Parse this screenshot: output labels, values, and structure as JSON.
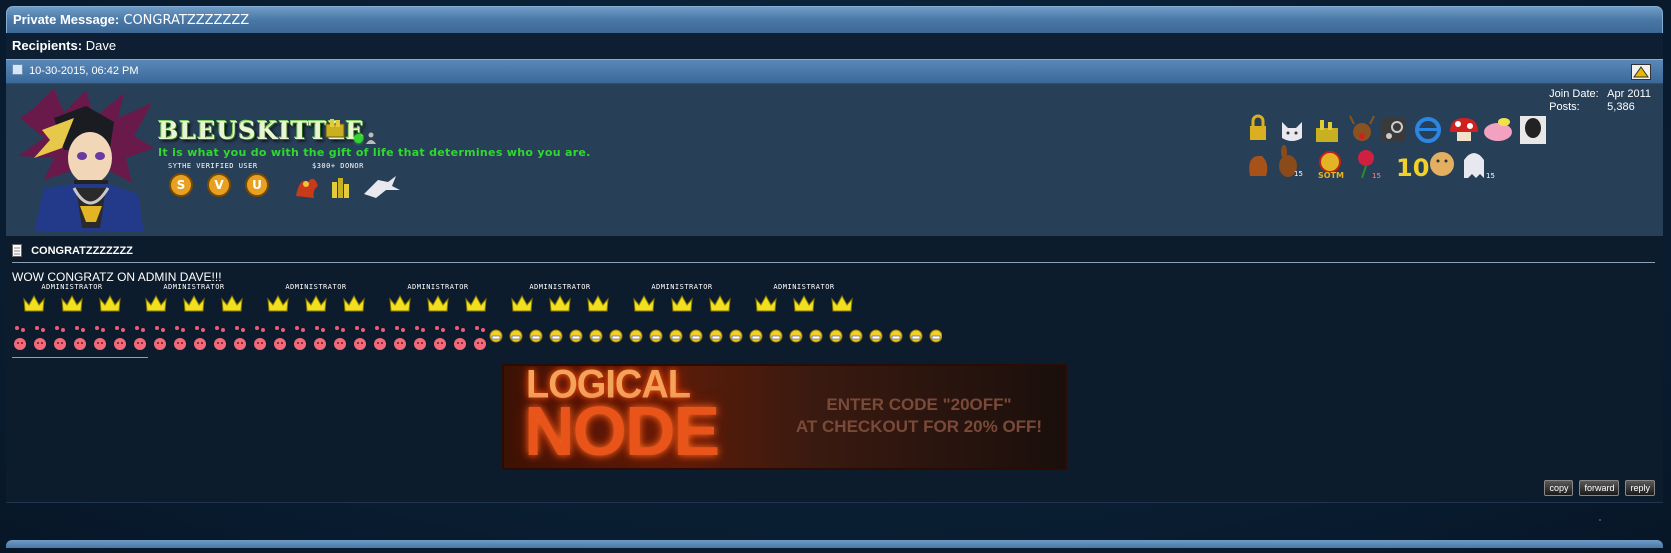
{
  "header": {
    "label": "Private Message:",
    "subject": "CONGRATZZZZZZZ"
  },
  "recipients": {
    "label": "Recipients:",
    "value": "Dave"
  },
  "post": {
    "date": "10-30-2015, 06:42 PM"
  },
  "user": {
    "name": "BLEUSKITTLE",
    "title": "It is what you do with the gift of life that determines who you are.",
    "rank_labels": [
      "SYTHE VERIFIED USER",
      "$300+ DONOR"
    ],
    "join_label": "Join Date:",
    "join_value": "Apr 2011",
    "posts_label": "Posts:",
    "posts_value": "5,386",
    "award_badges": [
      "15",
      "SOTM",
      "15",
      "10",
      "15"
    ]
  },
  "message": {
    "title": "CONGRATZZZZZZZ",
    "text": "WOW CONGRATZ ON ADMIN DAVE!!!",
    "admin_label": "ADMINISTRATOR",
    "admin_groups": 7
  },
  "banner": {
    "line1": "LOGICAL",
    "line2": "NODE",
    "code_line1": "ENTER CODE \"20OFF\"",
    "code_line2": "AT CHECKOUT FOR 20% OFF!"
  },
  "buttons": {
    "copy": "copy",
    "forward": "forward",
    "reply": "reply"
  }
}
